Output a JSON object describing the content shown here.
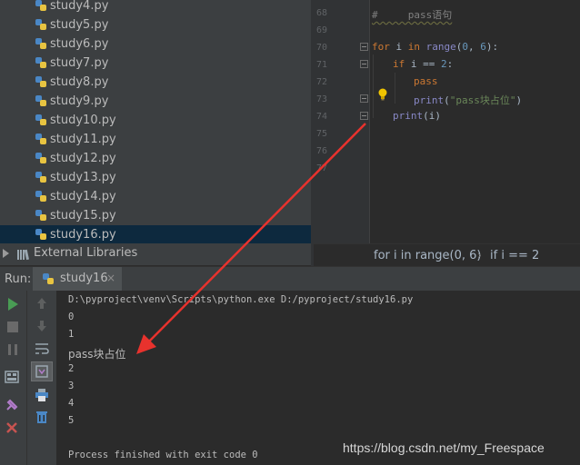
{
  "project_tree": {
    "files": [
      "study4.py",
      "study5.py",
      "study6.py",
      "study7.py",
      "study8.py",
      "study9.py",
      "study10.py",
      "study11.py",
      "study12.py",
      "study13.py",
      "study14.py",
      "study15.py",
      "study16.py"
    ],
    "selected": "study16.py",
    "external_libraries": "External Libraries"
  },
  "editor": {
    "line_numbers": [
      "68",
      "69",
      "70",
      "71",
      "72",
      "73",
      "74",
      "75",
      "76",
      "77"
    ],
    "code": {
      "comment": "#     pass语句",
      "for_kw": "for",
      "for_var": " i ",
      "in_kw": "in",
      "range_fn": " range",
      "paren_open": "(",
      "num0": "0",
      "comma": ", ",
      "num6": "6",
      "paren_close_colon": "):",
      "if_kw": "if",
      "if_cond": " i == ",
      "num2": "2",
      "colon": ":",
      "pass_kw": "pass",
      "print_fn": "print",
      "print_open": "(",
      "print_str": "\"pass块占位\"",
      "print_close": ")",
      "print_fn2": "print",
      "print_arg2": "(i)"
    },
    "breadcrumb": [
      "for i in range(0, 6)",
      "if i == 2"
    ],
    "breadcrumb_sep": "›"
  },
  "run": {
    "label": "Run:",
    "tab": "study16",
    "tab_close": "×",
    "console": [
      "D:\\pyproject\\venv\\Scripts\\python.exe D:/pyproject/study16.py",
      "0",
      "1",
      "pass块占位",
      "2",
      "3",
      "4",
      "5",
      "",
      "Process finished with exit code 0"
    ]
  },
  "watermark": "https://blog.csdn.net/my_Freespace",
  "colors": {
    "accent_arrow": "#e8322d",
    "selection": "#0d293e",
    "run_green": "#499c54",
    "stop_red": "#c75450"
  },
  "icons": [
    "python-file-icon",
    "library-icon",
    "run-icon",
    "stop-icon",
    "pause-icon",
    "up-arrow-icon",
    "down-arrow-icon",
    "soft-wrap-icon",
    "scroll-to-end-icon",
    "print-icon",
    "trash-icon",
    "layout-icon",
    "pin-icon",
    "close-icon",
    "bulb-icon"
  ]
}
